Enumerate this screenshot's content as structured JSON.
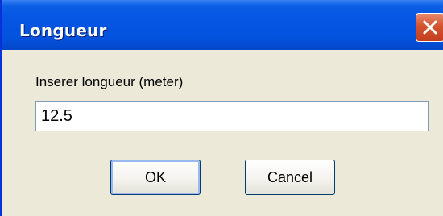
{
  "window": {
    "title": "Longueur",
    "close_icon": "close-icon"
  },
  "form": {
    "prompt": "Inserer longueur  (meter)",
    "value": "12.5"
  },
  "buttons": {
    "ok_label": "OK",
    "cancel_label": "Cancel"
  },
  "colors": {
    "titlebar": "#0554e3",
    "close_button": "#d3522f",
    "dialog_face": "#ece9d8"
  }
}
